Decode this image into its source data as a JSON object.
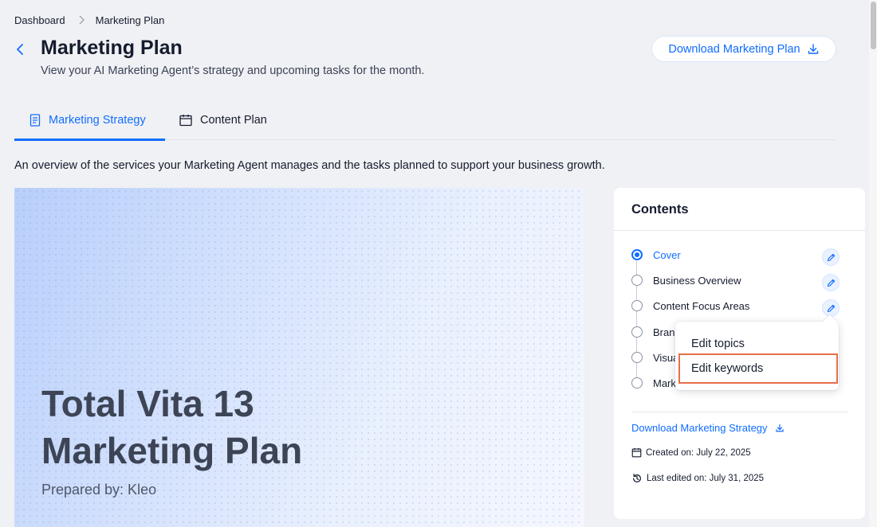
{
  "breadcrumb": {
    "items": [
      "Dashboard",
      "Marketing Plan"
    ]
  },
  "header": {
    "title": "Marketing Plan",
    "subtitle": "View your AI Marketing Agent’s strategy and upcoming tasks for the month.",
    "download_label": "Download Marketing Plan"
  },
  "tabs": [
    {
      "label": "Marketing Strategy",
      "icon": "document-icon",
      "active": true
    },
    {
      "label": "Content Plan",
      "icon": "calendar-icon",
      "active": false
    }
  ],
  "overview_text": "An overview of the services your Marketing Agent manages and the tasks planned to support your business growth.",
  "cover": {
    "title_line1": "Total Vita 13",
    "title_line2": "Marketing Plan",
    "prepared_by": "Prepared by: Kleo"
  },
  "contents": {
    "title": "Contents",
    "items": [
      {
        "label": "Cover",
        "selected": true
      },
      {
        "label": "Business Overview",
        "selected": false
      },
      {
        "label": "Content Focus Areas",
        "selected": false
      },
      {
        "label": "Brand",
        "selected": false
      },
      {
        "label": "Visua",
        "selected": false
      },
      {
        "label": "Mark",
        "selected": false
      }
    ],
    "download_strategy_label": "Download Marketing Strategy",
    "created_on": "Created on: July 22, 2025",
    "last_edited": "Last edited on: July 31, 2025"
  },
  "dropdown": {
    "items": [
      "Edit topics",
      "Edit keywords"
    ],
    "highlighted": "Edit keywords"
  },
  "colors": {
    "accent": "#116dff",
    "highlight_border": "#e76f4a",
    "text": "#151c2e"
  }
}
